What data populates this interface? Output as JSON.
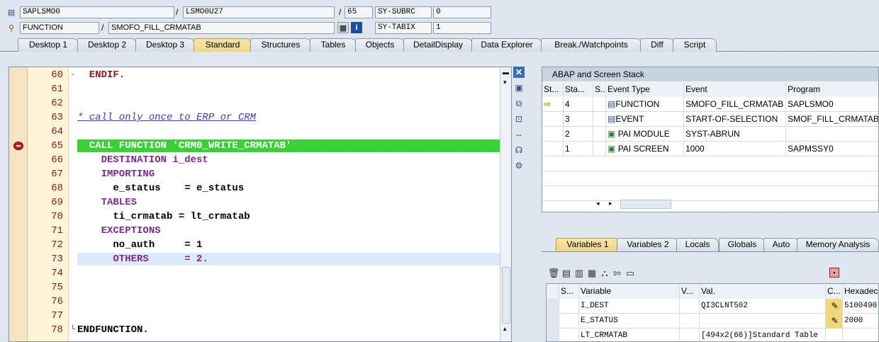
{
  "status": {
    "program": "SAPLSMO0",
    "include": "LSMO0U27",
    "line": "65",
    "subrc_label": "SY-SUBRC",
    "subrc_value": "0",
    "type": "FUNCTION",
    "name": "SMOFO_FILL_CRMATAB",
    "tabix_label": "SY-TABIX",
    "tabix_value": "1",
    "sep": "/"
  },
  "tabs": [
    "Desktop 1",
    "Desktop 2",
    "Desktop 3",
    "Standard",
    "Structures",
    "Tables",
    "Objects",
    "DetailDisplay",
    "Data Explorer",
    "Break./Watchpoints",
    "Diff",
    "Script"
  ],
  "editor": {
    "lines": [
      {
        "n": "60",
        "text": "  ENDIF."
      },
      {
        "n": "61",
        "text": ""
      },
      {
        "n": "62",
        "text": ""
      },
      {
        "n": "63",
        "text": "* call only once to ERP or CRM"
      },
      {
        "n": "64",
        "text": ""
      },
      {
        "n": "65",
        "text": "  CALL FUNCTION 'CRM0_WRITE_CRMATAB'"
      },
      {
        "n": "66",
        "text": "    DESTINATION i_dest"
      },
      {
        "n": "67",
        "text": "    IMPORTING"
      },
      {
        "n": "68",
        "text": "      e_status    = e_status"
      },
      {
        "n": "69",
        "text": "    TABLES"
      },
      {
        "n": "70",
        "text": "      ti_crmatab = lt_crmatab"
      },
      {
        "n": "71",
        "text": "    EXCEPTIONS"
      },
      {
        "n": "72",
        "text": "      no_auth     = 1"
      },
      {
        "n": "73",
        "text": "      OTHERS      = 2."
      },
      {
        "n": "74",
        "text": ""
      },
      {
        "n": "75",
        "text": ""
      },
      {
        "n": "76",
        "text": ""
      },
      {
        "n": "77",
        "text": ""
      },
      {
        "n": "78",
        "text": "ENDFUNCTION."
      }
    ]
  },
  "stack": {
    "title": "ABAP and Screen Stack",
    "headers": [
      "St...",
      "Sta...",
      "S...",
      "Event Type",
      "Event",
      "Program"
    ],
    "rows": [
      {
        "level": "4",
        "type": "FUNCTION",
        "event": "SMOFO_FILL_CRMATAB",
        "program": "SAPLSMO0"
      },
      {
        "level": "3",
        "type": "EVENT",
        "event": "START-OF-SELECTION",
        "program": "SMOF_FILL_CRMATAB"
      },
      {
        "level": "2",
        "type": "PAI MODULE",
        "event": "SYST-ABRUN",
        "program": ""
      },
      {
        "level": "1",
        "type": "PAI SCREEN",
        "event": "1000",
        "program": "SAPMSSY0"
      }
    ]
  },
  "var_tabs": [
    "Variables 1",
    "Variables 2",
    "Locals",
    "Globals",
    "Auto",
    "Memory Analysis"
  ],
  "vars": {
    "headers": [
      "S...",
      "Variable",
      "V...",
      "Val.",
      "C...",
      "Hexadeci"
    ],
    "rows": [
      {
        "name": "I_DEST",
        "value": "QI3CLNT502",
        "hex": "5100490"
      },
      {
        "name": "E_STATUS",
        "value": "",
        "hex": "2000"
      },
      {
        "name": "LT_CRMATAB",
        "value": "[494x2(66)]Standard Table",
        "hex": ""
      }
    ]
  }
}
